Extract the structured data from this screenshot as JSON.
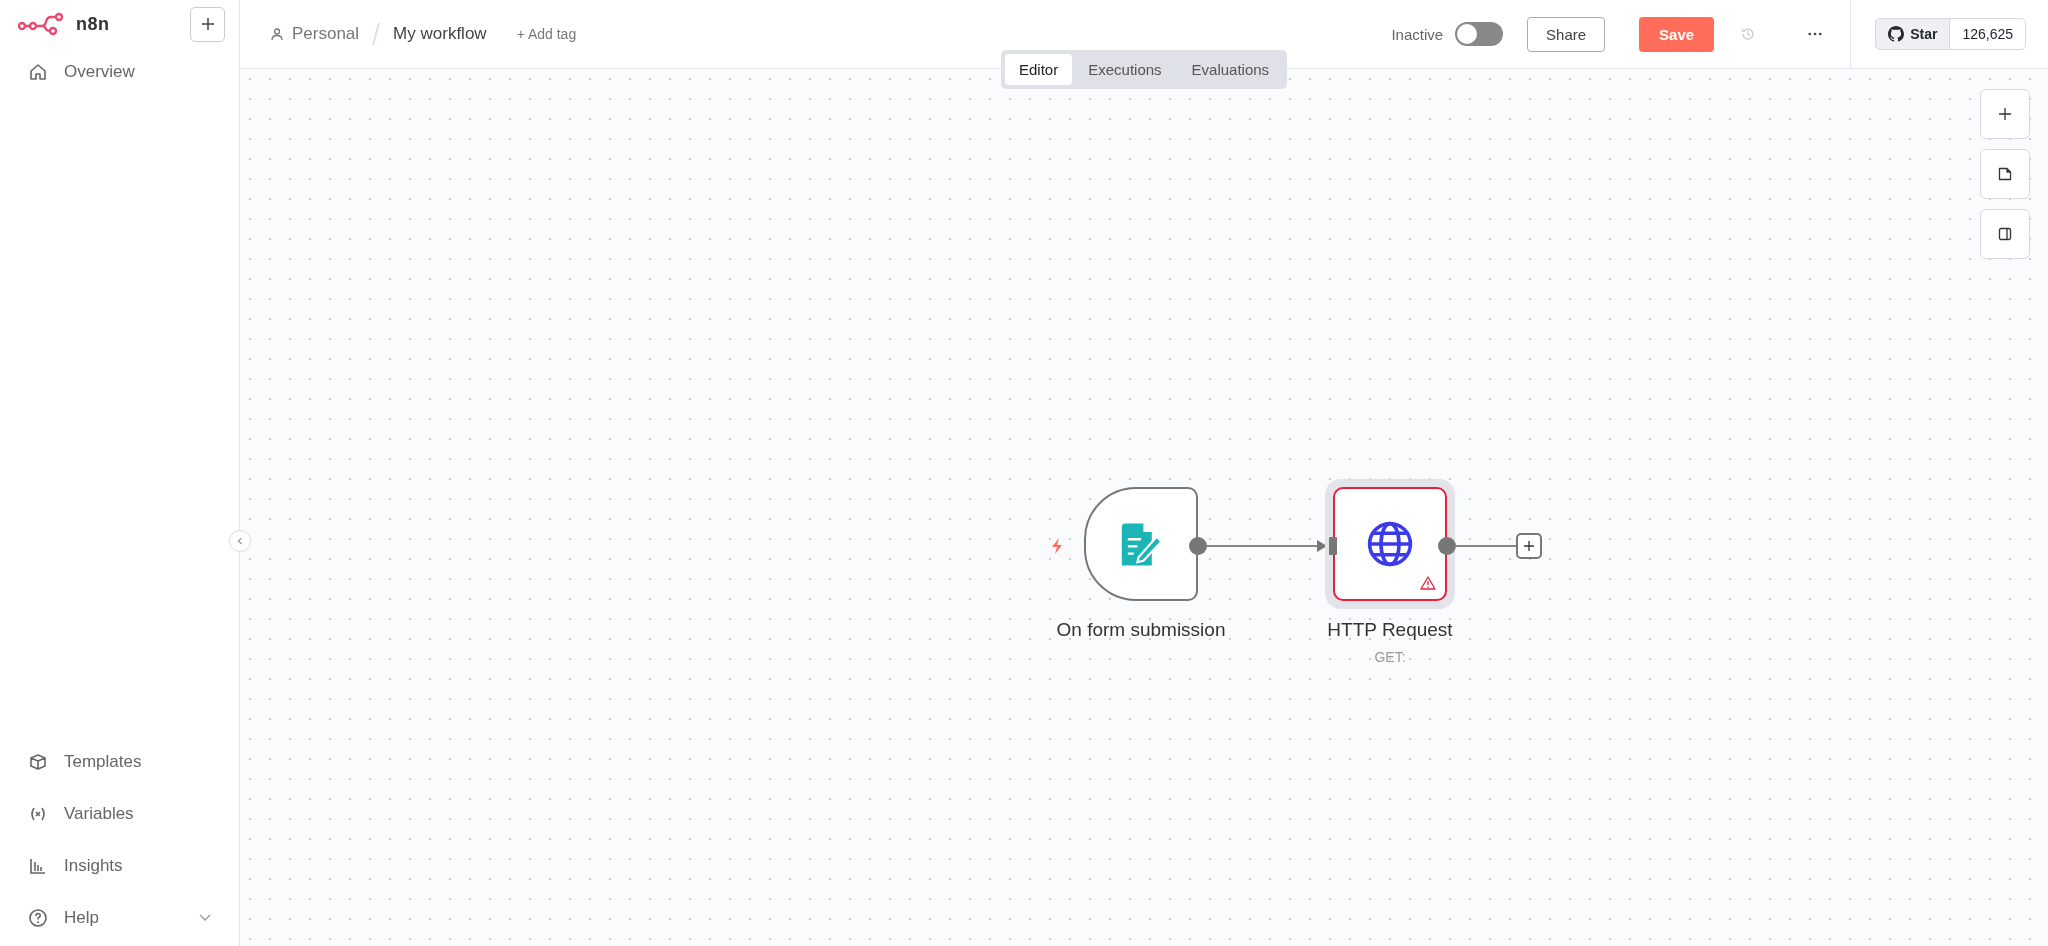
{
  "sidebar": {
    "logo_text": "n8n",
    "top_items": [
      {
        "label": "Overview"
      }
    ],
    "bottom_items": [
      {
        "label": "Templates",
        "expandable": false
      },
      {
        "label": "Variables",
        "expandable": false
      },
      {
        "label": "Insights",
        "expandable": false
      },
      {
        "label": "Help",
        "expandable": true
      }
    ]
  },
  "header": {
    "breadcrumb": [
      "Personal",
      "My workflow"
    ],
    "add_tag": "+ Add tag",
    "status": {
      "label": "Inactive",
      "on": false
    },
    "share": "Share",
    "save": "Save",
    "github": {
      "label": "Star",
      "count": "126,625"
    }
  },
  "tabs": [
    {
      "label": "Editor",
      "selected": true
    },
    {
      "label": "Executions",
      "selected": false
    },
    {
      "label": "Evaluations",
      "selected": false
    }
  ],
  "nodes": [
    {
      "kind": "trigger",
      "name": "On form submission",
      "selected": false,
      "warning": false
    },
    {
      "kind": "http",
      "name": "HTTP Request",
      "subtitle": "GET:",
      "selected": true,
      "warning": true
    }
  ]
}
